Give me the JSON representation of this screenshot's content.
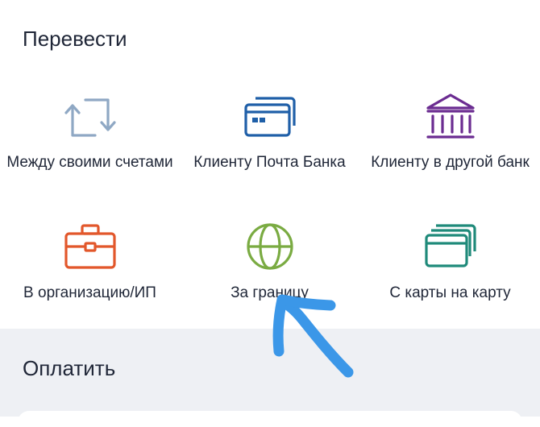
{
  "transfer": {
    "title": "Перевести",
    "tiles": [
      {
        "label": "Между своими счетами",
        "icon": "arrows-exchange-icon",
        "color": "#8fa8c4"
      },
      {
        "label": "Клиенту Почта Банка",
        "icon": "bank-card-icon",
        "color": "#1f5fa8"
      },
      {
        "label": "Клиенту в другой банк",
        "icon": "bank-building-icon",
        "color": "#6b2c91"
      },
      {
        "label": "В организацию/ИП",
        "icon": "briefcase-icon",
        "color": "#e2572b"
      },
      {
        "label": "За границу",
        "icon": "globe-icon",
        "color": "#7aab42"
      },
      {
        "label": "С карты на карту",
        "icon": "cards-icon",
        "color": "#1f8a7a"
      }
    ]
  },
  "pay": {
    "title": "Оплатить"
  },
  "annotation": {
    "color": "#3b97e8",
    "icon": "hand-drawn-arrow-icon"
  }
}
